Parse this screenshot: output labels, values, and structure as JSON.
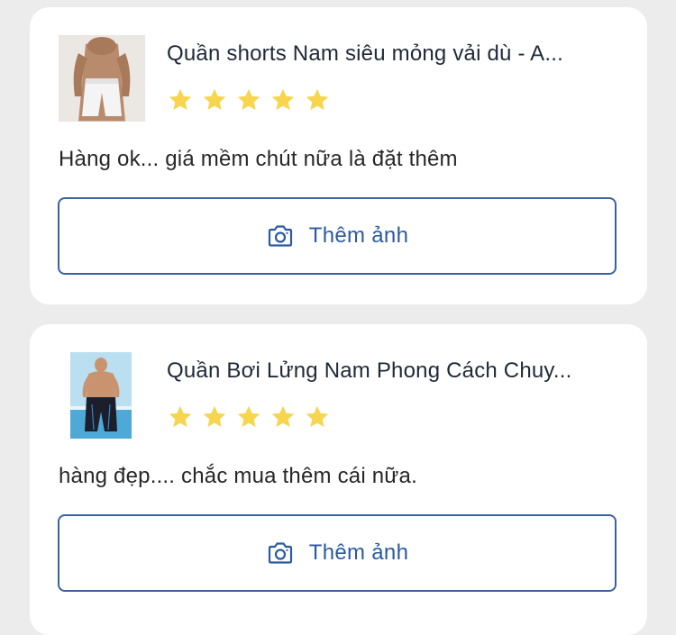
{
  "reviews": [
    {
      "product_title": "Quần shorts Nam siêu mỏng vải dù - A...",
      "rating": 5,
      "review_text": "Hàng ok... giá mềm chút nữa là đặt thêm",
      "add_photo_label": "Thêm ảnh",
      "thumbnail": "product-thumbnail-shorts"
    },
    {
      "product_title": "Quần Bơi Lửng Nam Phong Cách Chuy...",
      "rating": 5,
      "review_text": "hàng đẹp.... chắc mua thêm cái nữa.",
      "add_photo_label": "Thêm ảnh",
      "thumbnail": "product-thumbnail-swim-shorts"
    }
  ],
  "colors": {
    "star": "#f7d54e",
    "button_border": "#3a62a0",
    "button_text": "#2b5aa0",
    "card_bg": "#ffffff",
    "page_bg": "#ececec"
  },
  "icons": {
    "star": "star-icon",
    "add_photo": "camera-icon"
  }
}
